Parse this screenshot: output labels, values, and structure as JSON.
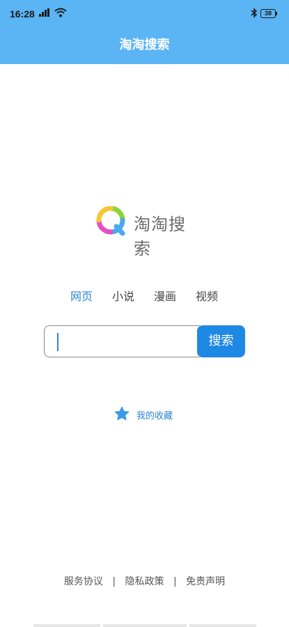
{
  "status": {
    "time": "16:28",
    "battery": "38",
    "icons": [
      "signal-icon",
      "wifi-icon",
      "bluetooth-icon",
      "battery-icon"
    ]
  },
  "header": {
    "title": "淘淘搜索",
    "bg_color": "#5bb4f4"
  },
  "logo": {
    "text": "淘淘搜索"
  },
  "tabs": [
    {
      "label": "网页",
      "active": true
    },
    {
      "label": "小说",
      "active": false
    },
    {
      "label": "漫画",
      "active": false
    },
    {
      "label": "视频",
      "active": false
    }
  ],
  "search": {
    "value": "",
    "placeholder": "",
    "button_label": "搜索",
    "button_color": "#1e88e5"
  },
  "favorites": {
    "label": "我的收藏",
    "icon": "star-icon",
    "color": "#2b84d6"
  },
  "footer": {
    "links": [
      "服务协议",
      "隐私政策",
      "免责声明"
    ],
    "separator": "|"
  }
}
